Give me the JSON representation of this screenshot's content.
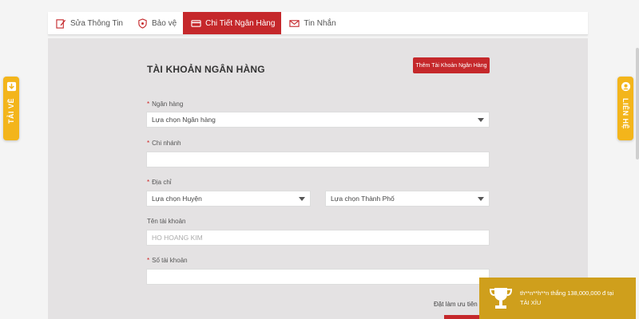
{
  "tabs": [
    {
      "label": "Sửa Thông Tin"
    },
    {
      "label": "Bảo vệ"
    },
    {
      "label": "Chi Tiết Ngân Hàng"
    },
    {
      "label": "Tin Nhắn"
    }
  ],
  "form": {
    "title": "TÀI KHOẢN NGÂN HÀNG",
    "add_button": "Thêm Tài Khoản Ngân Hàng",
    "bank": {
      "label": "Ngân hàng",
      "value": "Lựa chọn Ngân hàng"
    },
    "branch": {
      "label": "Chi nhánh",
      "value": ""
    },
    "address": {
      "label": "Địa chỉ",
      "district": "Lựa chọn Huyện",
      "city": "Lựa chọn Thành Phố"
    },
    "account_name": {
      "label": "Tên tài khoản",
      "value": "HO HOANG KIM"
    },
    "account_number": {
      "label": "Số tài khoản",
      "value": ""
    },
    "default_label": "Đặt làm ưu tiên"
  },
  "side": {
    "left_label": "TẢI VỀ",
    "right_label": "LIÊN HỆ"
  },
  "toast": {
    "message": "th**n**h**n thắng 138,000,000 đ tại",
    "game": "TÀI XỈU"
  },
  "colors": {
    "accent": "#c5282b",
    "side_tab": "#f3b51b",
    "toast": "#cf9f1c"
  }
}
